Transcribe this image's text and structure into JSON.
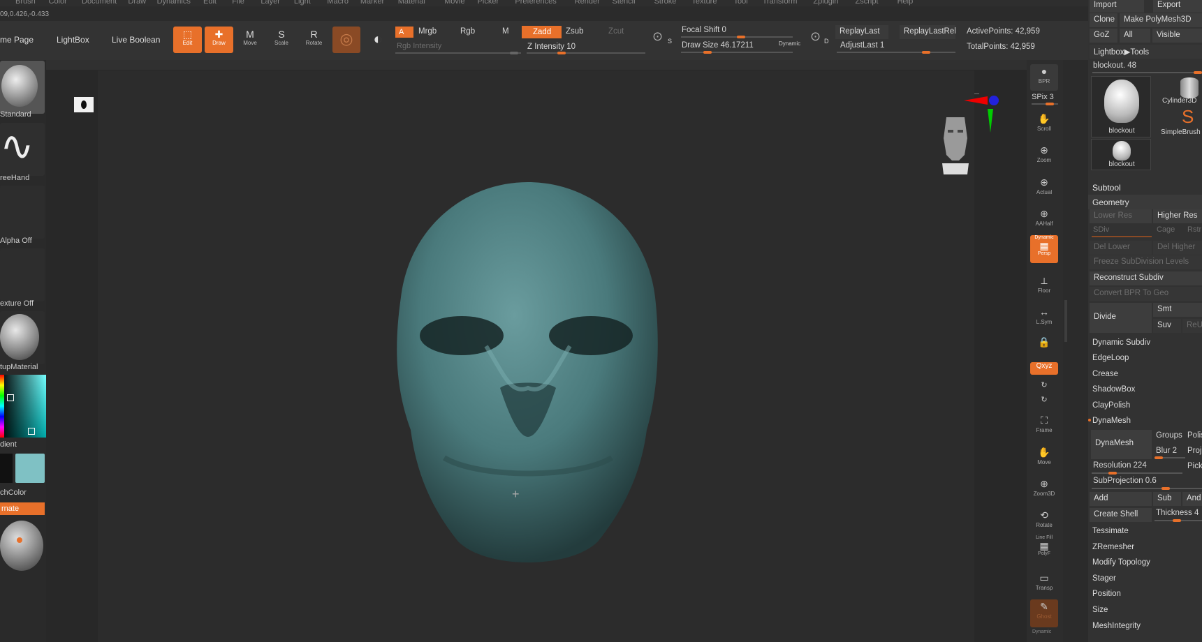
{
  "menu": [
    "Brush",
    "Color",
    "Document",
    "Draw",
    "Dynamics",
    "Edit",
    "File",
    "Layer",
    "Light",
    "Macro",
    "Marker",
    "Material",
    "Movie",
    "Picker",
    "Preferences",
    "Render",
    "Stencil",
    "Stroke",
    "Texture",
    "Tool",
    "Transform",
    "Zplugin",
    "Zscript",
    "Help"
  ],
  "coords": "09,0.426,-0.433",
  "toolbar": {
    "home_page": "me Page",
    "lightbox": "LightBox",
    "live_boolean": "Live Boolean",
    "edit": "Edit",
    "draw": "Draw",
    "move": "Move",
    "scale": "Scale",
    "rotate": "Rotate",
    "a": "A",
    "mrgb": "Mrgb",
    "rgb": "Rgb",
    "m": "M",
    "zadd": "Zadd",
    "zsub": "Zsub",
    "zcut": "Zcut",
    "rgb_intensity": "Rgb Intensity",
    "z_intensity": "Z Intensity 10",
    "focal_shift": "Focal Shift 0",
    "draw_size": "Draw Size 46.17211",
    "dynamic": "Dynamic",
    "replay_last": "ReplayLast",
    "replay_last_rel": "ReplayLastRel",
    "adjust_last": "AdjustLast 1",
    "active_points": "ActivePoints: 42,959",
    "total_points": "TotalPoints: 42,959",
    "s_label": "S",
    "d_label": "D"
  },
  "left": {
    "standard": "Standard",
    "freehand": "reeHand",
    "alpha_off": "Alpha Off",
    "texture_off": "exture Off",
    "material": "tupMaterial",
    "gradient": "dient",
    "switch_color": "chColor",
    "alternate": "rnate",
    "main_color": "#7fc1c4"
  },
  "right_strip": {
    "bpr": "BPR",
    "spix": "SPix 3",
    "scroll": "Scroll",
    "zoom": "Zoom",
    "actual": "Actual",
    "aahalf": "AAHalf",
    "dynamic": "Dynamic",
    "persp": "Persp",
    "floor": "Floor",
    "lsym": "L.Sym",
    "xyz": "Qxyz",
    "frame": "Frame",
    "move": "Move",
    "zoom3d": "Zoom3D",
    "rotate": "Rotate",
    "linefill": "Line Fill",
    "polyf": "PolyF",
    "transp": "Transp",
    "ghost": "Ghost",
    "dynamic2": "Dynamic"
  },
  "panel": {
    "import": "Import",
    "export": "Export",
    "clone": "Clone",
    "make_polymesh": "Make PolyMesh3D",
    "goz": "GoZ",
    "all": "All",
    "visible": "Visible",
    "lightbox_tools": "Lightbox▶Tools",
    "blockout": "blockout. 48",
    "thumb1": "blockout",
    "thumb2": "Cylinder3D",
    "thumb3": "SimpleBrush",
    "thumb4": "blockout",
    "subtool": "Subtool",
    "geometry": "Geometry",
    "lower_res": "Lower Res",
    "higher_res": "Higher Res",
    "sdiv": "SDiv",
    "cage": "Cage",
    "rstr": "Rstr",
    "del_lower": "Del Lower",
    "del_higher": "Del Higher",
    "freeze": "Freeze SubDivision Levels",
    "reconstruct": "Reconstruct Subdiv",
    "convert_bpr": "Convert BPR To Geo",
    "divide": "Divide",
    "smt": "Smt",
    "suv": "Suv",
    "reuv": "ReUV",
    "dynamic_subdiv": "Dynamic Subdiv",
    "edgeloop": "EdgeLoop",
    "crease": "Crease",
    "shadowbox": "ShadowBox",
    "claypolish": "ClayPolish",
    "dynamesh_header": "DynaMesh",
    "dynamesh_btn": "DynaMesh",
    "groups": "Groups",
    "polish": "Polish",
    "blur": "Blur 2",
    "project": "Project",
    "resolution": "Resolution 224",
    "pick": "Pick",
    "subprojection": "SubProjection 0.6",
    "add": "Add",
    "sub": "Sub",
    "and": "And",
    "create_shell": "Create Shell",
    "thickness": "Thickness 4",
    "tessimate": "Tessimate",
    "zremesher": "ZRemesher",
    "modify_topology": "Modify Topology",
    "stager": "Stager",
    "position": "Position",
    "size": "Size",
    "meshintegrity": "MeshIntegrity"
  },
  "colors": {
    "accent": "#e8702a",
    "skull": "#4c7c7e"
  }
}
